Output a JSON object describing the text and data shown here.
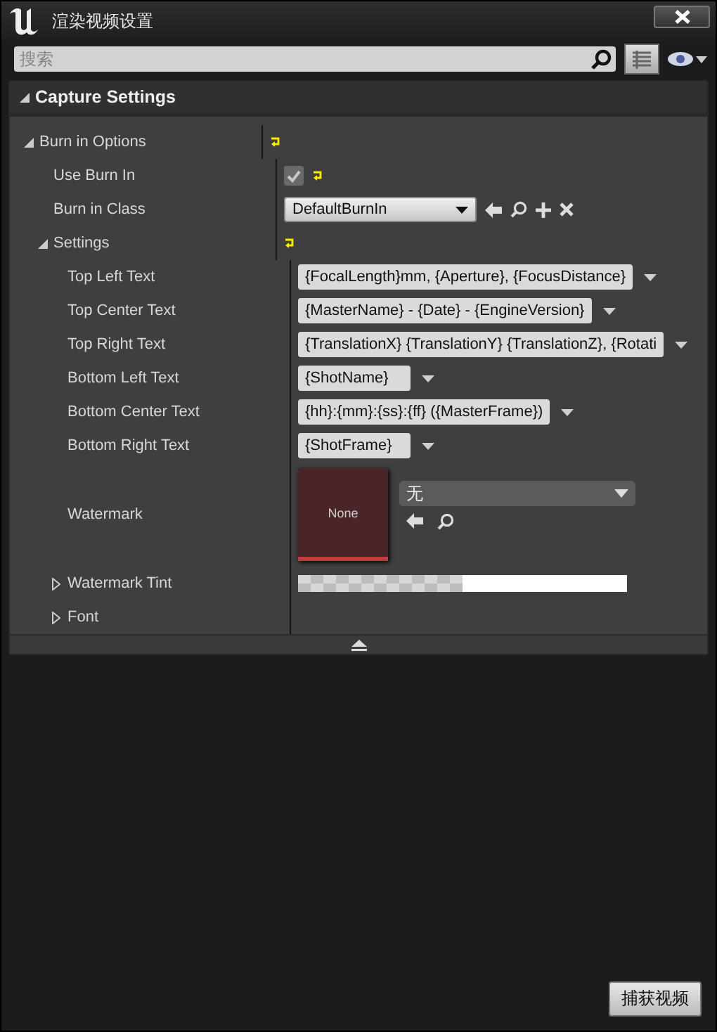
{
  "window": {
    "title": "渲染视频设置"
  },
  "search": {
    "placeholder": "搜索"
  },
  "section": {
    "title": "Capture Settings",
    "expanded": true
  },
  "properties": [
    {
      "label": "Burn in Options",
      "kind": "group",
      "expanded": true,
      "modified": true,
      "children": [
        {
          "label": "Use Burn In",
          "kind": "checkbox",
          "checked": true,
          "modified": true
        },
        {
          "label": "Burn in Class",
          "kind": "class",
          "value": "DefaultBurnIn",
          "modified": false
        },
        {
          "label": "Settings",
          "kind": "group",
          "expanded": true,
          "modified": true,
          "children": [
            {
              "label": "Top Left Text",
              "kind": "text",
              "value": "{FocalLength}mm, {Aperture}, {FocusDistance}",
              "modified": false
            },
            {
              "label": "Top Center Text",
              "kind": "text",
              "value": "{MasterName} - {Date} - {EngineVersion}",
              "modified": false
            },
            {
              "label": "Top Right Text",
              "kind": "text",
              "value": "{TranslationX} {TranslationY} {TranslationZ}, {Rotati",
              "modified": false
            },
            {
              "label": "Bottom Left Text",
              "kind": "text",
              "value": "{ShotName}",
              "modified": false
            },
            {
              "label": "Bottom Center Text",
              "kind": "text",
              "value": "{hh}:{mm}:{ss}:{ff} ({MasterFrame})",
              "modified": false
            },
            {
              "label": "Bottom Right Text",
              "kind": "text",
              "value": "{ShotFrame}",
              "modified": false
            },
            {
              "label": "Watermark",
              "kind": "texture",
              "thumbnail": "None",
              "value": "无",
              "modified": false
            },
            {
              "label": "Watermark Tint",
              "kind": "color",
              "expanded": false,
              "modified": false
            },
            {
              "label": "Font",
              "kind": "group",
              "expanded": false,
              "modified": false
            }
          ]
        }
      ]
    }
  ],
  "buttons": [
    {
      "label": "捕获视频"
    }
  ]
}
